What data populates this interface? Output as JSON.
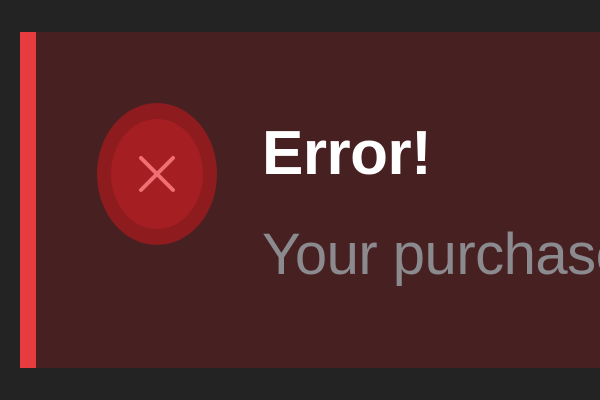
{
  "toast": {
    "type": "error",
    "title": "Error!",
    "message": "Your purchase",
    "icon": "error-x-circle-icon"
  },
  "colors": {
    "page_background": "#232323",
    "toast_background": "#472022",
    "accent": "#e63c3f",
    "icon_outer": "#8e1c1f",
    "icon_inner": "#a41e22",
    "icon_glyph": "#ef6f72",
    "title": "#ffffff",
    "message": "#8a8a8f"
  }
}
